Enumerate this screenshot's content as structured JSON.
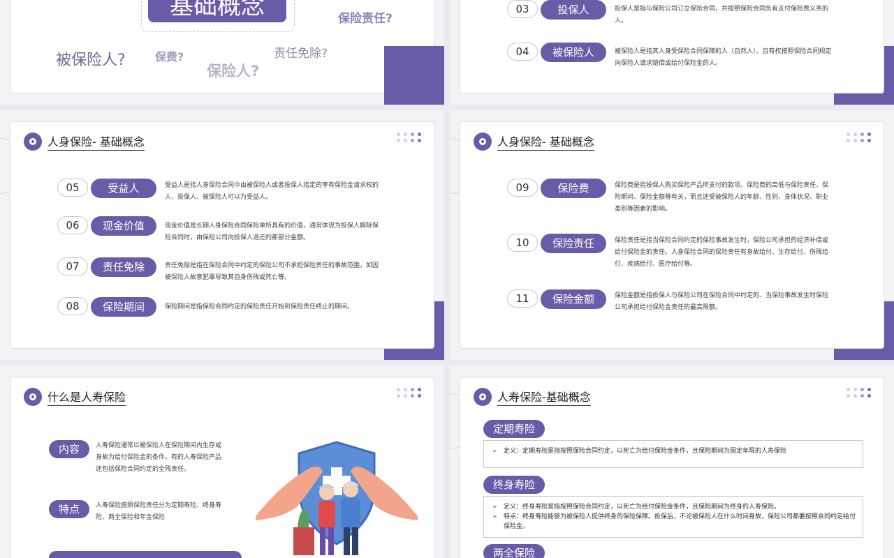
{
  "slide1": {
    "title_box": "基础概念",
    "questions": [
      "保险责任?",
      "被保险人?",
      "保费?",
      "责任免除?",
      "保险人?"
    ]
  },
  "slide2": {
    "items": [
      {
        "num": "03",
        "label": "投保人",
        "desc": "投保人是指与保险公司订立保险合同，并按照保险合同负有支付保险费义务的人。"
      },
      {
        "num": "04",
        "label": "被保险人",
        "desc": "被保险人是指其人身受保险合同保障的人（自然人）。且有权按照保险合同规定向保险人请求赔偿或给付保险金的人。"
      }
    ]
  },
  "slide3": {
    "title": "人身保险- 基础概念",
    "items": [
      {
        "num": "05",
        "label": "受益人",
        "desc": "受益人是指人身保险合同中由被保险人或者投保人指定的享有保险金请求权的人，投保人、被保险人可以为受益人。"
      },
      {
        "num": "06",
        "label": "现金价值",
        "desc": "现金价值是长期人身保险合同保险单所具有的价值，通常体现为投保人解除保险合同时，由保险公司向投保人退还的那部分金额。"
      },
      {
        "num": "07",
        "label": "责任免除",
        "desc": "责任免除是指在保险合同中约定的保险公司不承担保险责任的事故范围，如因被保险人故意犯罪导致其自身伤残或死亡等。"
      },
      {
        "num": "08",
        "label": "保险期间",
        "desc": "保险期间是指保险合同约定的保险责任开始到保险责任终止的期间。"
      }
    ]
  },
  "slide4": {
    "title": "人身保险- 基础概念",
    "items": [
      {
        "num": "09",
        "label": "保险费",
        "desc": "保险费是指投保人购买保险产品所支付的款项。保险费的高低与保险责任、保险期间、保险金额等有关，而且还受被保险人的年龄、性别、身体状况、职业类别等因素的影响。"
      },
      {
        "num": "10",
        "label": "保险责任",
        "desc": "保险责任是指当保险合同约定的保险事故发生时，保险公司承担的经济补偿或给付保险金的责任。人身保险合同的保险责任有身故给付、生存给付、伤残给付、疾病给付、医疗给付等。"
      },
      {
        "num": "11",
        "label": "保险金额",
        "desc": "保险金额是指投保人与保险公司在保险合同中约定的、当保险事故发生时保险公司承担给付保险金责任的最高限额。"
      }
    ]
  },
  "slide5": {
    "title": "什么是人寿保险",
    "items": [
      {
        "label": "内容",
        "desc": "人寿保险通常以被保险人在保险期间内生存或身故为给付保险金的条件。有的人寿保险产品还包括保险合同约定的全残责任。"
      },
      {
        "label": "特点",
        "desc": "人寿保险按照保险责任分为定期寿险、终身寿险、两全保险和年金保险"
      }
    ]
  },
  "slide6": {
    "title": "人寿保险-基础概念",
    "sections": [
      {
        "label": "定期寿险",
        "lines": [
          "定义：定期寿险是指按照保险合同约定，以死亡为给付保险金条件，且保险期间为固定年限的人寿保险"
        ]
      },
      {
        "label": "终身寿险",
        "lines": [
          "定义：终身寿险是指按照保险合同约定，以死亡为给付保险金条件，且保险期间为终身的人寿保险。",
          "特点：终身寿险能够为被保险人提供终身的保险保障。投保后，不论被保险人在什么时间身故，保险公司都要按照合同约定给付保险金。"
        ]
      },
      {
        "label": "两全保险",
        "lines": []
      }
    ]
  }
}
